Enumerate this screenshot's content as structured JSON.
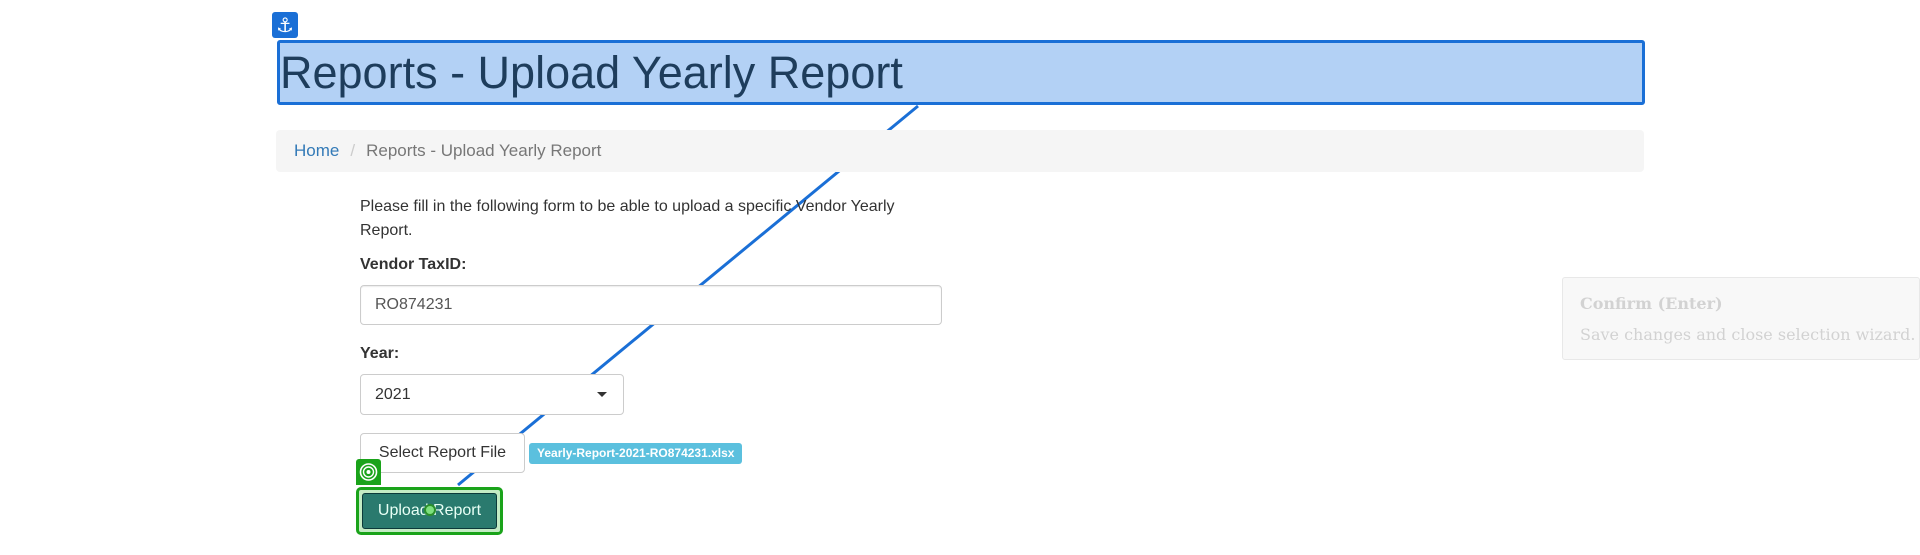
{
  "header": {
    "title": "Reports - Upload Yearly Report"
  },
  "breadcrumb": {
    "home": "Home",
    "current": "Reports - Upload Yearly Report"
  },
  "form": {
    "intro": "Please fill in the following form to be able to upload a specific Vendor Yearly Report.",
    "taxid_label": "Vendor TaxID:",
    "taxid_value": "RO874231",
    "year_label": "Year:",
    "year_value": "2021",
    "file_button_label": "Select Report File",
    "selected_file": "Yearly-Report-2021-RO874231.xlsx",
    "upload_button_label": "Upload Report"
  },
  "tooltip": {
    "title": "Confirm (Enter)",
    "description": "Save changes and close selection wizard."
  },
  "overlay": {
    "title_highlight_color": "#1a6fd6",
    "target_highlight_color": "#1aa31a",
    "anchor_icon": "anchor-icon",
    "target_icon": "target-icon"
  }
}
